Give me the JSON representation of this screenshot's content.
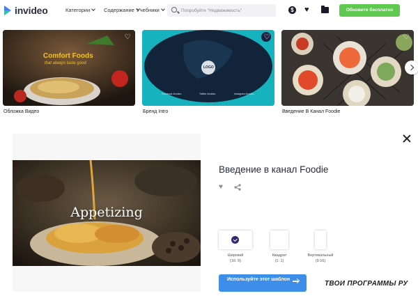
{
  "app": {
    "logo_text": "invideo"
  },
  "header": {
    "nav": [
      {
        "label": "Категории"
      },
      {
        "label": "Содержание"
      },
      {
        "label": "Учебники"
      }
    ],
    "search_placeholder": "Попробуйте \"Недвижимость\"",
    "icons": [
      "dollar-icon",
      "heart-icon",
      "folder-icon"
    ],
    "cta_label": "Обновите бесплатно",
    "cta_color": "#5ec94e"
  },
  "gallery": {
    "cards": [
      {
        "label": "Обложка Видео",
        "overlay_title": "Comfort Foods",
        "overlay_sub": "that always taste good"
      },
      {
        "label": "Бренд Intro",
        "logo_text": "LOGO",
        "socials": [
          "Facebook /invideo",
          "Twitter /invideo",
          "Instagram /invideo"
        ]
      },
      {
        "label": "Введение В Канал Foodie"
      }
    ]
  },
  "modal": {
    "video_title": "Appetizing",
    "title": "Введение в канал Foodie",
    "formats": [
      {
        "label": "Широкий",
        "ratio": "(16: 9)",
        "selected": true
      },
      {
        "label": "Квадрат",
        "ratio": "(1: 1)",
        "selected": false
      },
      {
        "label": "Вертикальный",
        "ratio": "(9:16)",
        "selected": false
      }
    ],
    "use_button_label": "Используйте этот шаблон",
    "accent_color": "#3c8ee8"
  },
  "watermark": "ТВОИ ПРОГРАММЫ РУ"
}
